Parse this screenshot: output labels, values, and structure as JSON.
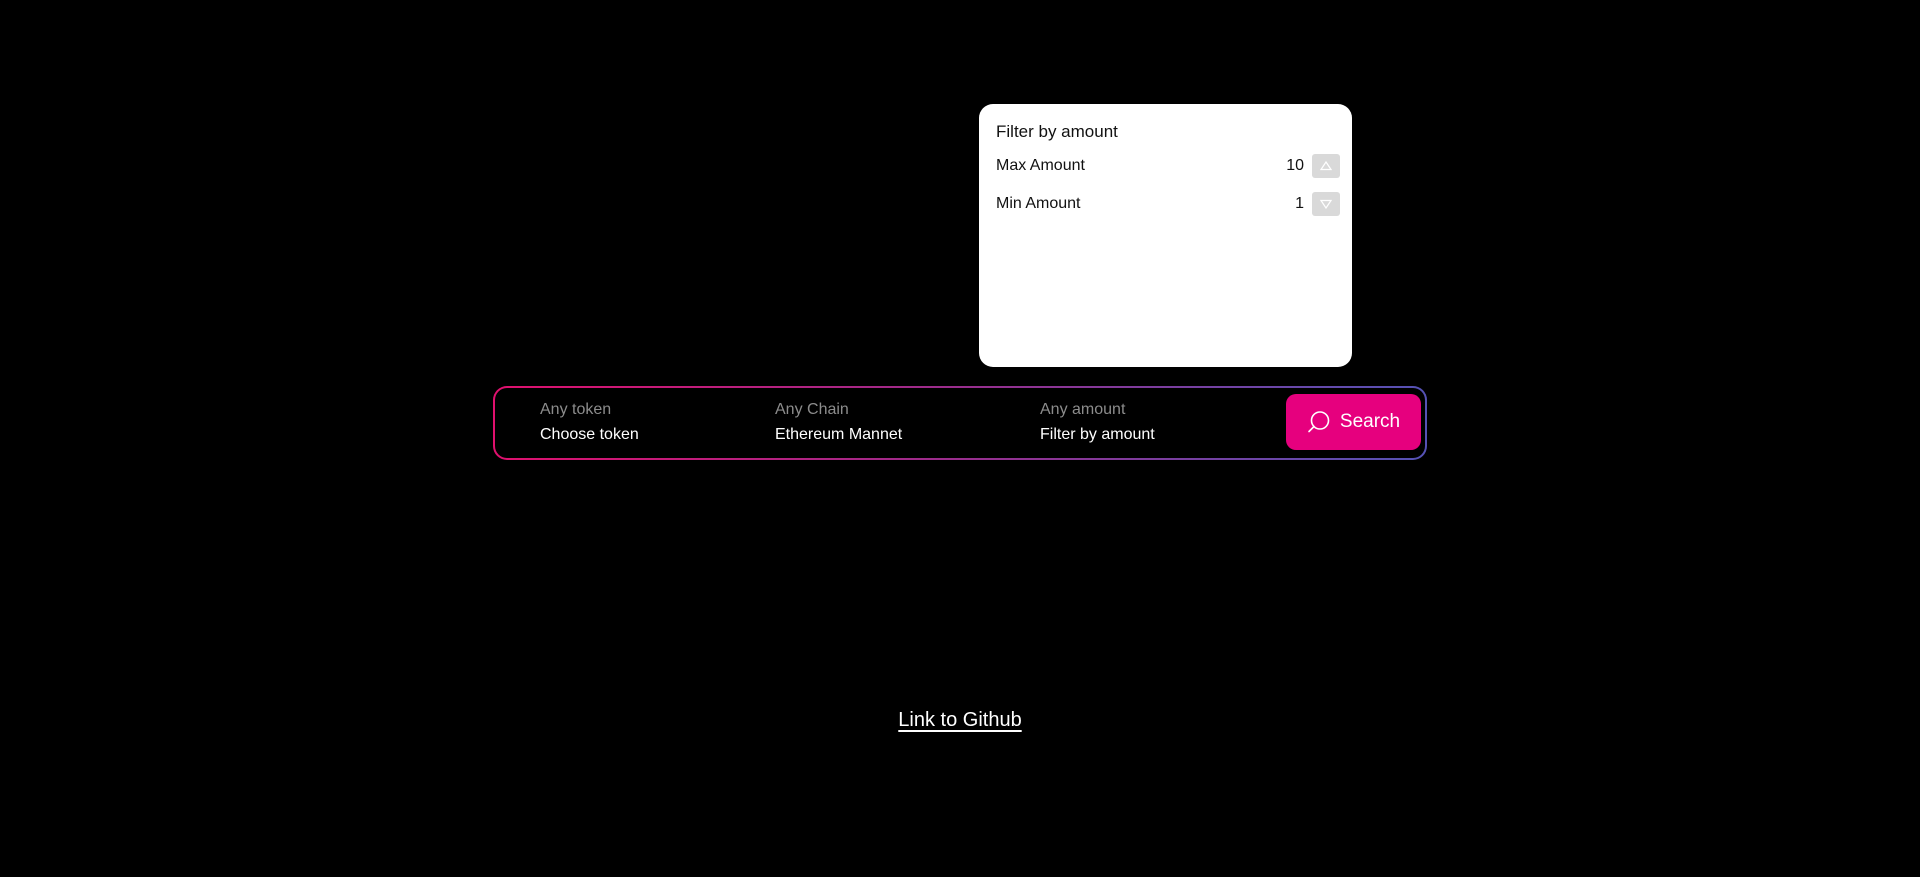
{
  "amount_filter": {
    "title": "Filter by amount",
    "max": {
      "label": "Max Amount",
      "value": "10",
      "icon": "triangle-up-icon"
    },
    "min": {
      "label": "Min Amount",
      "value": "1",
      "icon": "triangle-down-icon"
    }
  },
  "search_bar": {
    "token": {
      "label": "Any token",
      "value": "Choose token"
    },
    "chain": {
      "label": "Any Chain",
      "value": "Ethereum Mannet"
    },
    "amount": {
      "label": "Any amount",
      "value": "Filter by amount"
    },
    "search_button": {
      "label": "Search",
      "icon": "search-icon"
    }
  },
  "footer": {
    "github_link": "Link to Github"
  },
  "colors": {
    "background": "#000000",
    "accent": "#e6007e",
    "gradient_start": "#e0106e",
    "gradient_end": "#5552b5"
  }
}
